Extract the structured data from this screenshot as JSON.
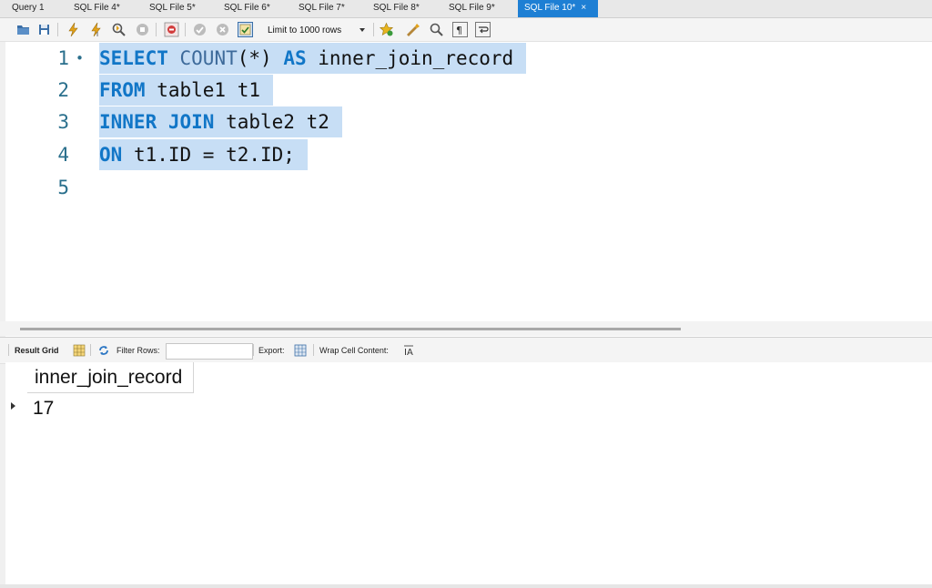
{
  "tabs": [
    {
      "label": "Query 1",
      "active": false
    },
    {
      "label": "SQL File 4*",
      "active": false
    },
    {
      "label": "SQL File 5*",
      "active": false
    },
    {
      "label": "SQL File 6*",
      "active": false
    },
    {
      "label": "SQL File 7*",
      "active": false
    },
    {
      "label": "SQL File 8*",
      "active": false
    },
    {
      "label": "SQL File 9*",
      "active": false
    },
    {
      "label": "SQL File 10*",
      "active": true
    }
  ],
  "tab_close_glyph": "×",
  "toolbar": {
    "limit_select": "Limit to 1000 rows",
    "icons": [
      "open-folder-icon",
      "save-icon",
      "execute-icon",
      "execute-selection-icon",
      "explain-icon",
      "stop-icon",
      "toggle-error-icon",
      "commit-icon",
      "rollback-icon",
      "autocommit-icon",
      "bookmark-icon",
      "beautify-icon",
      "find-icon",
      "invisible-chars-icon",
      "wrap-icon"
    ]
  },
  "editor": {
    "line_numbers": [
      "1",
      "2",
      "3",
      "4",
      "5"
    ],
    "current_line_marker": "•",
    "lines": [
      {
        "tokens": [
          {
            "t": "SELECT",
            "c": "kw"
          },
          {
            "t": " ",
            "c": ""
          },
          {
            "t": "COUNT",
            "c": "fn"
          },
          {
            "t": "(*) ",
            "c": ""
          },
          {
            "t": "AS",
            "c": "kw"
          },
          {
            "t": " inner_join_record",
            "c": ""
          }
        ]
      },
      {
        "tokens": [
          {
            "t": "FROM",
            "c": "kw"
          },
          {
            "t": " table1 t1",
            "c": ""
          }
        ]
      },
      {
        "tokens": [
          {
            "t": "INNER",
            "c": "kw"
          },
          {
            "t": " ",
            "c": ""
          },
          {
            "t": "JOIN",
            "c": "kw"
          },
          {
            "t": " table2 t2",
            "c": ""
          }
        ]
      },
      {
        "tokens": [
          {
            "t": "ON",
            "c": "kw"
          },
          {
            "t": " t1.ID = t2.ID;",
            "c": ""
          }
        ]
      }
    ]
  },
  "result_toolbar": {
    "result_grid": "Result Grid",
    "filter_rows": "Filter Rows:",
    "filter_value": "",
    "export": "Export:",
    "wrap_cell": "Wrap Cell Content:"
  },
  "grid": {
    "columns": [
      "inner_join_record"
    ],
    "rows": [
      [
        "17"
      ]
    ]
  },
  "colors": {
    "active_tab": "#1e7fd4",
    "keyword": "#1176c7",
    "selection": "#c7def5",
    "line_number": "#2a6f8c"
  }
}
